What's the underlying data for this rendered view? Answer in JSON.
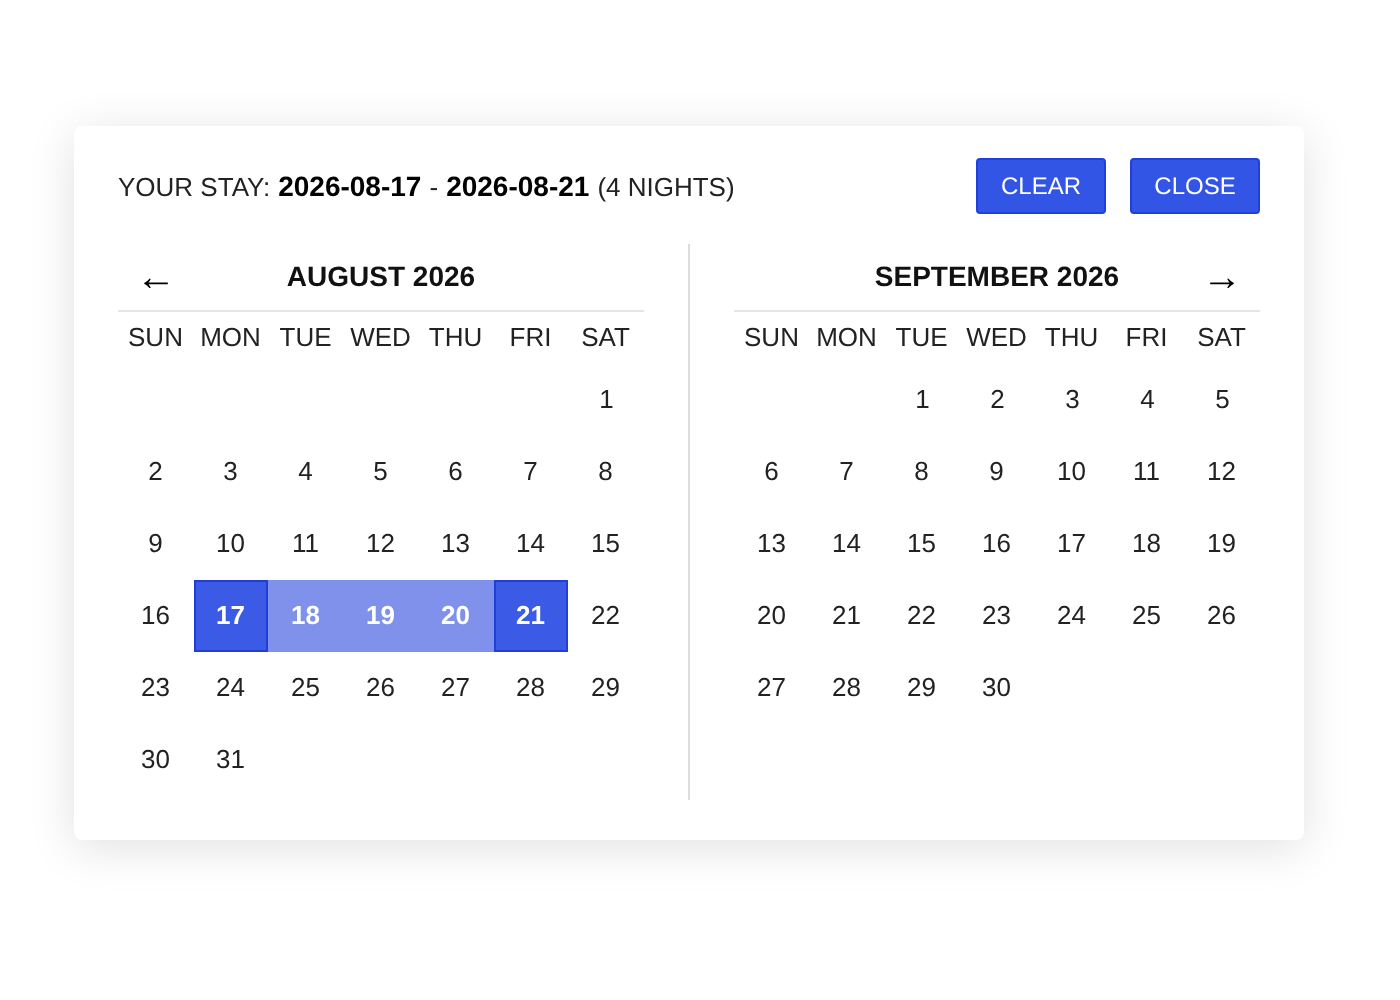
{
  "header": {
    "label": "YOUR STAY:",
    "start": "2026-08-17",
    "separator": "-",
    "end": "2026-08-21",
    "nights": "(4 NIGHTS)"
  },
  "buttons": [
    "CLEAR",
    "CLOSE"
  ],
  "months": [
    {
      "title": "AUGUST 2026",
      "prev": "←",
      "weekdays": [
        "SUN",
        "MON",
        "TUE",
        "WED",
        "THU",
        "FRI",
        "SAT"
      ],
      "weeks": [
        {
          "leading_gap": true,
          "days": [
            {
              "day": "1",
              "selected": false,
              "in_range": false
            }
          ]
        },
        {
          "leading_gap": false,
          "days": [
            {
              "day": "2",
              "selected": false,
              "in_range": false
            },
            {
              "day": "3",
              "selected": false,
              "in_range": false
            },
            {
              "day": "4",
              "selected": false,
              "in_range": false
            },
            {
              "day": "5",
              "selected": false,
              "in_range": false
            },
            {
              "day": "6",
              "selected": false,
              "in_range": false
            },
            {
              "day": "7",
              "selected": false,
              "in_range": false
            },
            {
              "day": "8",
              "selected": false,
              "in_range": false
            }
          ]
        },
        {
          "leading_gap": false,
          "days": [
            {
              "day": "9",
              "selected": false,
              "in_range": false
            },
            {
              "day": "10",
              "selected": false,
              "in_range": false
            },
            {
              "day": "11",
              "selected": false,
              "in_range": false
            },
            {
              "day": "12",
              "selected": false,
              "in_range": false
            },
            {
              "day": "13",
              "selected": false,
              "in_range": false
            },
            {
              "day": "14",
              "selected": false,
              "in_range": false
            },
            {
              "day": "15",
              "selected": false,
              "in_range": false
            }
          ]
        },
        {
          "leading_gap": false,
          "days": [
            {
              "day": "16",
              "selected": false,
              "in_range": false
            },
            {
              "day": "17",
              "selected": true,
              "in_range": false
            },
            {
              "day": "18",
              "selected": false,
              "in_range": true
            },
            {
              "day": "19",
              "selected": false,
              "in_range": true
            },
            {
              "day": "20",
              "selected": false,
              "in_range": true
            },
            {
              "day": "21",
              "selected": true,
              "in_range": false
            },
            {
              "day": "22",
              "selected": false,
              "in_range": false
            }
          ]
        },
        {
          "leading_gap": false,
          "days": [
            {
              "day": "23",
              "selected": false,
              "in_range": false
            },
            {
              "day": "24",
              "selected": false,
              "in_range": false
            },
            {
              "day": "25",
              "selected": false,
              "in_range": false
            },
            {
              "day": "26",
              "selected": false,
              "in_range": false
            },
            {
              "day": "27",
              "selected": false,
              "in_range": false
            },
            {
              "day": "28",
              "selected": false,
              "in_range": false
            },
            {
              "day": "29",
              "selected": false,
              "in_range": false
            }
          ]
        },
        {
          "leading_gap": false,
          "days": [
            {
              "day": "30",
              "selected": false,
              "in_range": false
            },
            {
              "day": "31",
              "selected": false,
              "in_range": false
            }
          ]
        }
      ]
    },
    {
      "title": "SEPTEMBER 2026",
      "next": "→",
      "weekdays": [
        "SUN",
        "MON",
        "TUE",
        "WED",
        "THU",
        "FRI",
        "SAT"
      ],
      "weeks": [
        {
          "leading_gap": true,
          "days": [
            {
              "day": "1",
              "selected": false,
              "in_range": false
            },
            {
              "day": "2",
              "selected": false,
              "in_range": false
            },
            {
              "day": "3",
              "selected": false,
              "in_range": false
            },
            {
              "day": "4",
              "selected": false,
              "in_range": false
            },
            {
              "day": "5",
              "selected": false,
              "in_range": false
            }
          ]
        },
        {
          "leading_gap": false,
          "days": [
            {
              "day": "6",
              "selected": false,
              "in_range": false
            },
            {
              "day": "7",
              "selected": false,
              "in_range": false
            },
            {
              "day": "8",
              "selected": false,
              "in_range": false
            },
            {
              "day": "9",
              "selected": false,
              "in_range": false
            },
            {
              "day": "10",
              "selected": false,
              "in_range": false
            },
            {
              "day": "11",
              "selected": false,
              "in_range": false
            },
            {
              "day": "12",
              "selected": false,
              "in_range": false
            }
          ]
        },
        {
          "leading_gap": false,
          "days": [
            {
              "day": "13",
              "selected": false,
              "in_range": false
            },
            {
              "day": "14",
              "selected": false,
              "in_range": false
            },
            {
              "day": "15",
              "selected": false,
              "in_range": false
            },
            {
              "day": "16",
              "selected": false,
              "in_range": false
            },
            {
              "day": "17",
              "selected": false,
              "in_range": false
            },
            {
              "day": "18",
              "selected": false,
              "in_range": false
            },
            {
              "day": "19",
              "selected": false,
              "in_range": false
            }
          ]
        },
        {
          "leading_gap": false,
          "days": [
            {
              "day": "20",
              "selected": false,
              "in_range": false
            },
            {
              "day": "21",
              "selected": false,
              "in_range": false
            },
            {
              "day": "22",
              "selected": false,
              "in_range": false
            },
            {
              "day": "23",
              "selected": false,
              "in_range": false
            },
            {
              "day": "24",
              "selected": false,
              "in_range": false
            },
            {
              "day": "25",
              "selected": false,
              "in_range": false
            },
            {
              "day": "26",
              "selected": false,
              "in_range": false
            }
          ]
        },
        {
          "leading_gap": false,
          "days": [
            {
              "day": "27",
              "selected": false,
              "in_range": false
            },
            {
              "day": "28",
              "selected": false,
              "in_range": false
            },
            {
              "day": "29",
              "selected": false,
              "in_range": false
            },
            {
              "day": "30",
              "selected": false,
              "in_range": false
            }
          ]
        }
      ]
    }
  ]
}
